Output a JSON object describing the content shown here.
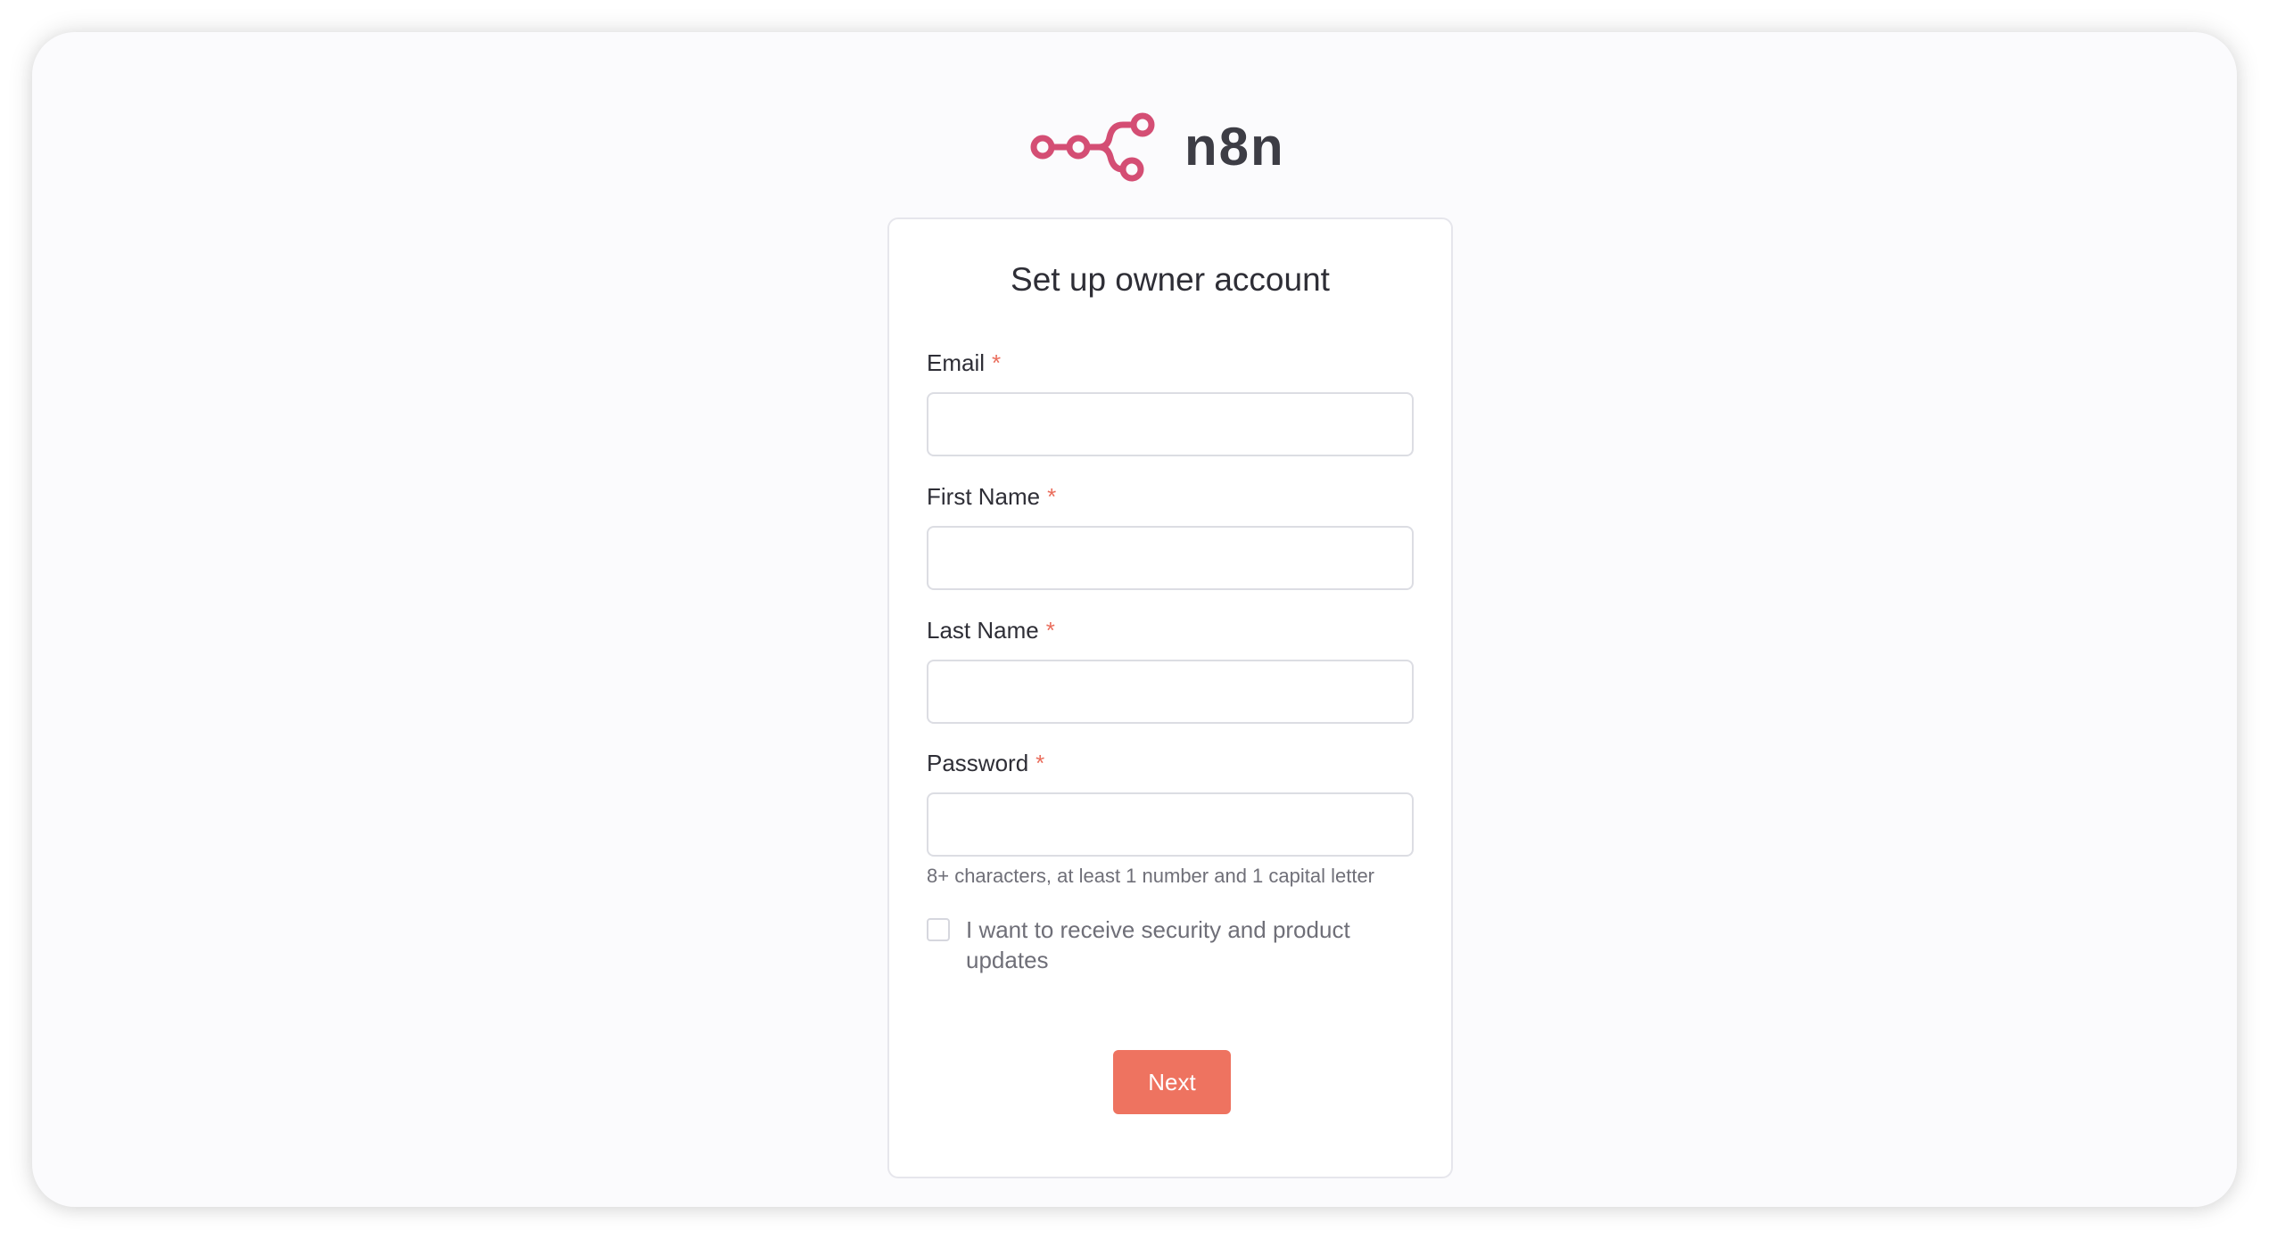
{
  "brand": {
    "name": "n8n",
    "logo_color": "#d44e74",
    "accent_color": "#ee7360"
  },
  "form": {
    "title": "Set up owner account",
    "required_marker": "*",
    "fields": [
      {
        "label": "Email",
        "value": "",
        "type": "email"
      },
      {
        "label": "First Name",
        "value": "",
        "type": "text"
      },
      {
        "label": "Last Name",
        "value": "",
        "type": "text"
      },
      {
        "label": "Password",
        "value": "",
        "type": "password"
      }
    ],
    "password_hint": "8+ characters, at least 1 number and 1 capital letter",
    "updates_checkbox": {
      "label": "I want to receive security and product updates",
      "checked": false
    },
    "next_label": "Next"
  }
}
